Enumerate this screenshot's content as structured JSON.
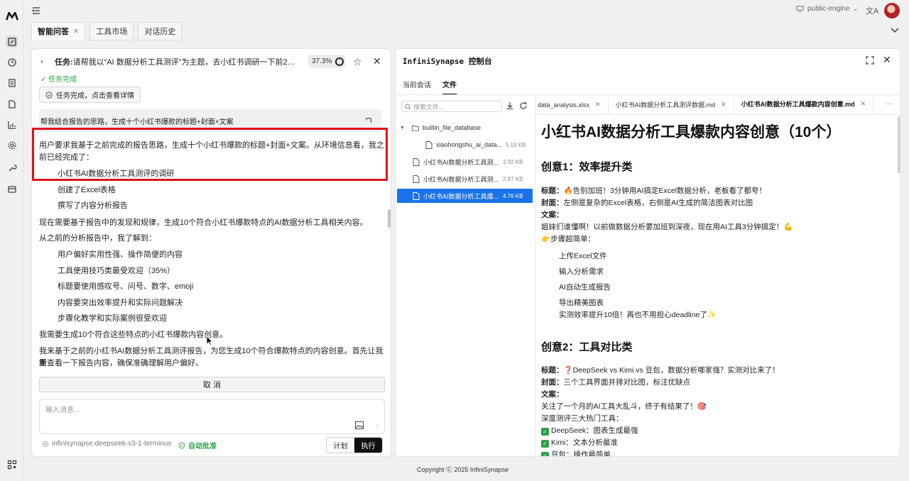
{
  "topbar": {
    "engine_label": "public-engine",
    "translate_glyph": "文A"
  },
  "tabs": [
    {
      "label": "智能问答",
      "close": "✕"
    },
    {
      "label": "工具市场"
    },
    {
      "label": "对话历史"
    }
  ],
  "chat": {
    "task_prefix": "任务:",
    "task_text": "请帮我以“AI 数据分析工具测评”为主题，去小红书调研一下前20篇点赞量最...",
    "progress": "37.3%",
    "done_text": "✓ 任务完成",
    "details_label": "任务完成，点击查看详情",
    "user_prompt": "帮我结合报告的思路，生成十个小红书爆款的标题+封面+文案",
    "lines": [
      "用户要求我基于之前完成的报告思路，生成十个小红书爆款的标题+封面+文案。从环境信息看，我之",
      "前已经完成了：",
      "小红书AI数据分析工具测评的调研",
      "创建了Excel表格",
      "撰写了内容分析报告",
      "现在需要基于报告中的发现和规律，生成10个符合小红书爆款特点的AI数据分析工具相关内容。",
      "从之前的分析报告中，我了解到：",
      "用户偏好实用性强、操作简便的内容",
      "工具使用技巧类最受欢迎（35%）",
      "标题要使用感叹号、问号、数字、emoji",
      "内容要突出效率提升和实际问题解决",
      "步骤化教学和实际案例很受欢迎",
      "我需要生成10个符合这些特点的小红书爆款内容创意。",
      "我来基于之前的小红书AI数据分析工具测评报告，为您生成10个符合爆款特点的内容创意。首先让我重",
      "新查看一下报告内容，确保准确理解用户偏好。"
    ],
    "cancel_label": "取 消",
    "input_placeholder": "输入消息...",
    "model_label": "infinisynapse:deepseek-v3-1-terminus",
    "auto_approve_label": "自动批准",
    "plan_label": "计划",
    "exec_label": "执行"
  },
  "console": {
    "title": "InfiniSynapse 控制台",
    "subtabs": [
      "当前会话",
      "文件"
    ],
    "search_placeholder": "搜索文件...",
    "tree": [
      {
        "name": "builtin_file_database",
        "size": ""
      },
      {
        "name": "xiaohongshu_ai_data...",
        "size": "5.15 KB"
      },
      {
        "name": "小红书AI数据分析工具测...",
        "size": "3.92 KB"
      },
      {
        "name": "小红书AI数据分析工具测...",
        "size": "2.87 KB"
      },
      {
        "name": "小红书AI数据分析工具爆...",
        "size": "4.76 KB"
      }
    ],
    "editor_tabs": [
      {
        "label": "data_analysis.xlsx"
      },
      {
        "label": "小红书AI数据分析工具测评数据.md"
      },
      {
        "label": "小红书AI数据分析工具爆款内容创意.md"
      }
    ],
    "more": "···",
    "doc": {
      "h1": "小红书AI数据分析工具爆款内容创意（10个）",
      "s1_h": "创意1：效率提升类",
      "s1_title_label": "标题：",
      "s1_title": "🔥告别加班！3分钟用AI搞定Excel数据分析，老板看了都夸！",
      "s1_cover_label": "封面：",
      "s1_cover": "左侧是复杂的Excel表格，右侧是AI生成的简洁图表对比图",
      "s1_copy_label": "文案：",
      "s1_copy1": "姐妹们谁懂啊！以前做数据分析要加班到深夜，现在用AI工具3分钟搞定！💪",
      "s1_copy2": "👉步骤超简单：",
      "s1_steps": [
        "上传Excel文件",
        "输入分析需求",
        "AI自动生成报告",
        "导出精美图表"
      ],
      "s1_end": "实测效率提升10倍！再也不用担心deadline了✨",
      "s2_h": "创意2：工具对比类",
      "s2_title": "❓DeepSeek vs Kimi vs 豆包，数据分析哪家强？实测对比来了！",
      "s2_cover": "三个工具界面并排对比图，标注优缺点",
      "s2_copy1": "关注了一个月的AI工具大乱斗，终于有结果了！🎯",
      "s2_copy2": "深度测评三大热门工具：",
      "s2_checks": [
        "DeepSeek：图表生成最强",
        "Kimi：文本分析最准",
        "豆包：操作最简单"
      ]
    }
  },
  "footer": {
    "copyright": "Copyright Ⓒ 2025 InfiniSynapse"
  }
}
